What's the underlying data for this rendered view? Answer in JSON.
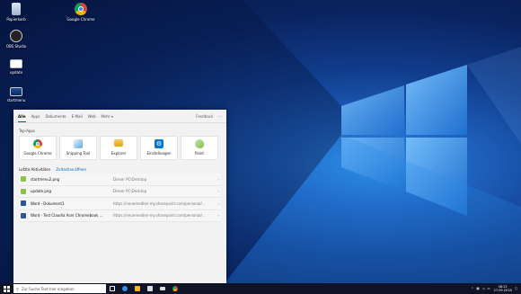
{
  "desktop": {
    "icons": [
      {
        "name": "recycle-bin",
        "label": "Papierkorb"
      },
      {
        "name": "google-chrome",
        "label": "Google Chrome"
      },
      {
        "name": "obs-studio",
        "label": "OBS Studio"
      },
      {
        "name": "update",
        "label": "update"
      },
      {
        "name": "startmenu",
        "label": "startmenu"
      }
    ]
  },
  "panel": {
    "tabs": [
      "Alle",
      "Apps",
      "Dokumente",
      "E-Mail",
      "Web",
      "Mehr ▾"
    ],
    "right": [
      "Feedback",
      "···"
    ],
    "top_apps_title": "Top-Apps",
    "top_apps": [
      {
        "label": "Google Chrome",
        "color": "#db4437"
      },
      {
        "label": "Snipping Tool",
        "color": "#5aa9e6"
      },
      {
        "label": "Explorer",
        "color": "#f2b51c"
      },
      {
        "label": "Einstellungen",
        "color": "#0078d7"
      },
      {
        "label": "Paint",
        "color": "#7fbf4d"
      }
    ],
    "recent_title": "Letzte Aktivitäten",
    "recent_link": "Zeitachse öffnen",
    "recent": [
      {
        "name": "startmenu2.png",
        "loc": "Dieser PC\\Desktop",
        "color": "#8bc34a"
      },
      {
        "name": "update.png",
        "loc": "Dieser PC\\Desktop",
        "color": "#8bc34a"
      },
      {
        "name": "Word - Dokument1",
        "loc": "https://neuemedien-my.sharepoint.com/personal/...",
        "color": "#2b579a"
      },
      {
        "name": "Word - Test Claudia Acer Chromebook ...",
        "loc": "https://neuemedien-my.sharepoint.com/personal/...",
        "color": "#2b579a"
      }
    ]
  },
  "taskbar": {
    "search_placeholder": "Zur Suche Text hier eingeben",
    "time": "08:22",
    "date": "27.09.2018"
  }
}
